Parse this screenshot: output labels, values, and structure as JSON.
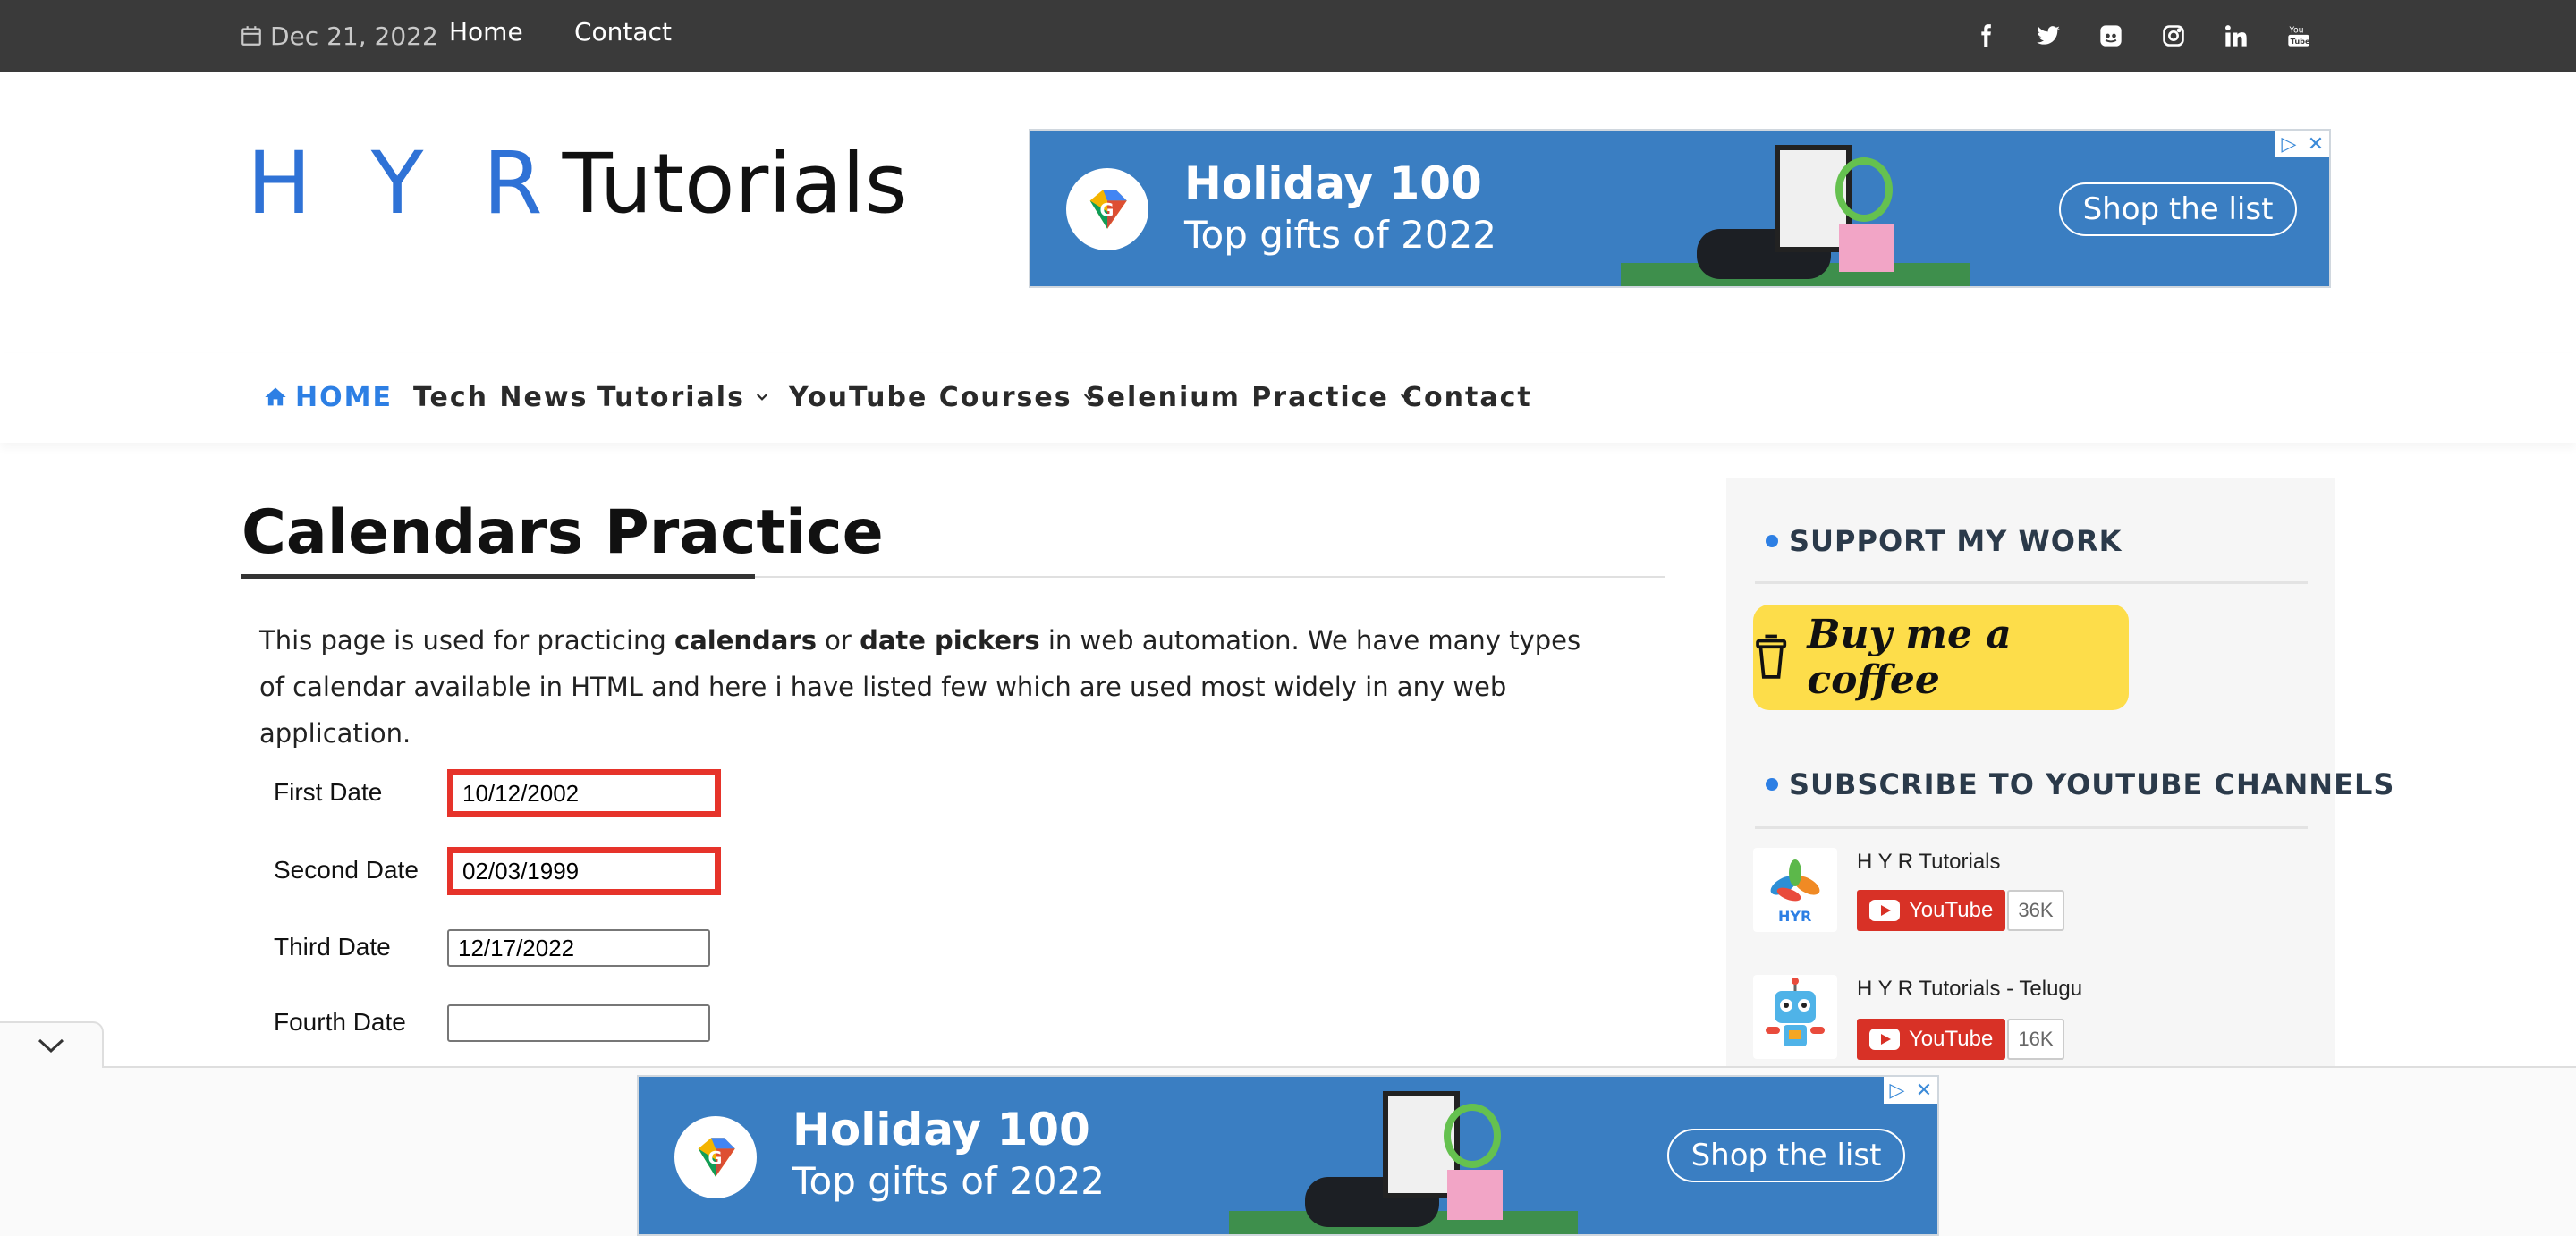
{
  "topbar": {
    "date": "Dec 21, 2022",
    "links": [
      "Home",
      "Contact"
    ],
    "social": [
      "facebook-icon",
      "twitter-icon",
      "discord-icon",
      "instagram-icon",
      "linkedin-icon",
      "youtube-icon"
    ]
  },
  "header": {
    "logo_hyr": "H Y R",
    "logo_tutorials": "Tutorials"
  },
  "ad": {
    "title": "Holiday 100",
    "subtitle": "Top gifts of 2022",
    "cta": "Shop the list"
  },
  "nav": {
    "home": "HOME",
    "tech_news": "Tech News",
    "tutorials": "Tutorials",
    "youtube_courses": "YouTube Courses",
    "selenium_practice": "Selenium Practice",
    "contact": "Contact"
  },
  "main": {
    "title": "Calendars Practice",
    "intro_1": "This page is used for practicing ",
    "intro_bold_1": "calendars",
    "intro_2": " or ",
    "intro_bold_2": "date pickers",
    "intro_3": " in web automation. We have many types of calendar available in HTML and here i have listed few which are used most widely in any web application.",
    "fields": [
      {
        "label": "First Date",
        "value": "10/12/2002"
      },
      {
        "label": "Second Date",
        "value": "02/03/1999"
      },
      {
        "label": "Third Date",
        "value": "12/17/2022"
      },
      {
        "label": "Fourth Date",
        "value": ""
      }
    ]
  },
  "sidebar": {
    "support_title": "SUPPORT MY WORK",
    "coffee_label": "Buy me a coffee",
    "subscribe_title": "SUBSCRIBE TO YOUTUBE CHANNELS",
    "channels": [
      {
        "name": "H Y R Tutorials",
        "button": "YouTube",
        "count": "36K"
      },
      {
        "name": "H Y R Tutorials - Telugu",
        "button": "YouTube",
        "count": "16K"
      }
    ]
  },
  "colors": {
    "topbar": "#3a3a3a",
    "accent": "#2d7fe4",
    "ad_bg": "#3a7ec2",
    "highlight_border": "#e6332a",
    "coffee_bg": "#fddd4a",
    "youtube_red": "#d83126"
  }
}
